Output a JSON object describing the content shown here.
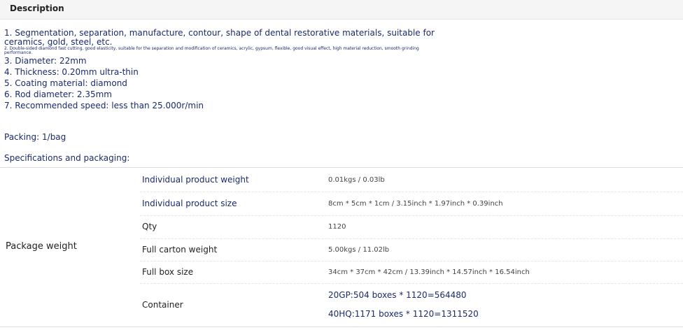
{
  "header": {
    "title": "Description"
  },
  "description": {
    "lines": [
      "1. Segmentation, separation, manufacture, contour, shape of dental restorative materials, suitable for",
      "ceramics, gold, steel, etc.",
      "2. Double-sided diamond fast cutting, good elasticity, suitable for the separation and modification of ceramics, acrylic, gypsum, flexible, good visual effect, high material reduction, smooth grinding",
      "performance.",
      "3. Diameter: 22mm",
      "4. Thickness: 0.20mm ultra-thin",
      "5. Coating material: diamond",
      "6. Rod diameter: 2.35mm",
      "7. Recommended speed: less than 25.000r/min"
    ]
  },
  "packing": "Packing: 1/bag",
  "specs_title": "Specifications and packaging:",
  "table": {
    "group_label": "Package weight",
    "rows": [
      {
        "key": "Individual product weight",
        "value": "0.01kgs / 0.03lb"
      },
      {
        "key": "Individual product size",
        "value": "8cm * 5cm * 1cm / 3.15inch * 1.97inch * 0.39inch"
      },
      {
        "key": "Qty",
        "value": "1120"
      },
      {
        "key": "Full carton weight",
        "value": "5.00kgs / 11.02lb"
      },
      {
        "key": "Full box size",
        "value": "34cm * 37cm * 42cm / 13.39inch * 14.57inch * 16.54inch"
      },
      {
        "key": "Container",
        "values": [
          "20GP:504 boxes * 1120=564480",
          "40HQ:1171 boxes * 1120=1311520"
        ]
      }
    ]
  }
}
